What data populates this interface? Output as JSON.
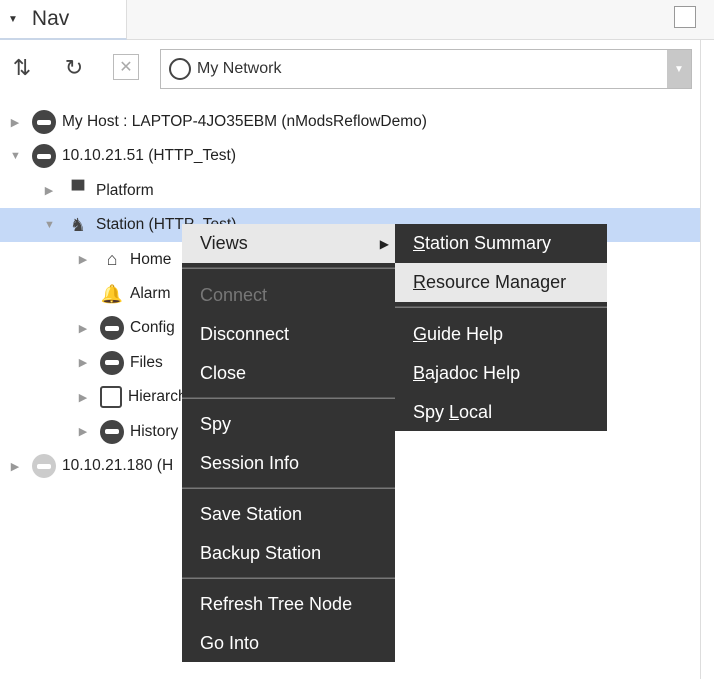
{
  "tab": {
    "title": "Nav"
  },
  "toolbar": {
    "network": "My Network"
  },
  "tree": [
    {
      "label": "My Host : LAPTOP-4JO35EBM (nModsReflowDemo)",
      "icon": "host-icon",
      "state": "collapsed"
    },
    {
      "label": "10.10.21.51 (HTTP_Test)",
      "icon": "host-icon",
      "state": "expanded"
    },
    {
      "label": "Platform",
      "icon": "platform-icon",
      "state": "collapsed"
    },
    {
      "label": "Station (HTTP_Test)",
      "icon": "station-icon",
      "state": "expanded",
      "selected": true
    },
    {
      "label": "Home",
      "icon": "home-icon",
      "state": "collapsed"
    },
    {
      "label": "Alarm",
      "icon": "bell-icon",
      "state": "none"
    },
    {
      "label": "Config",
      "icon": "database-icon",
      "state": "collapsed"
    },
    {
      "label": "Files",
      "icon": "files-icon",
      "state": "collapsed"
    },
    {
      "label": "Hierarchy",
      "icon": "hierarchy-icon",
      "state": "collapsed"
    },
    {
      "label": "History",
      "icon": "history-icon",
      "state": "collapsed"
    },
    {
      "label": "10.10.21.180 (H",
      "icon": "host-icon",
      "state": "collapsed"
    }
  ],
  "menu": {
    "views": "Views",
    "connect": "Connect",
    "disconnect": "Disconnect",
    "close": "Close",
    "spy": "Spy",
    "session_info": "Session Info",
    "save_station": "Save Station",
    "backup_station": "Backup Station",
    "refresh": "Refresh Tree Node",
    "go_into": "Go Into"
  },
  "submenu": {
    "station_summary": {
      "u": "S",
      "rest": "tation Summary"
    },
    "resource_manager": {
      "u": "R",
      "rest": "esource Manager"
    },
    "guide_help": {
      "u": "G",
      "rest": "uide Help"
    },
    "bajadoc_help": {
      "u": "B",
      "rest": "ajadoc Help"
    },
    "spy_local": {
      "pre": "Spy ",
      "u": "L",
      "rest": "ocal"
    }
  },
  "colors": {
    "selection": "#c5d9f7",
    "menu_bg": "#333333",
    "menu_highlight": "#e8e8e8"
  }
}
